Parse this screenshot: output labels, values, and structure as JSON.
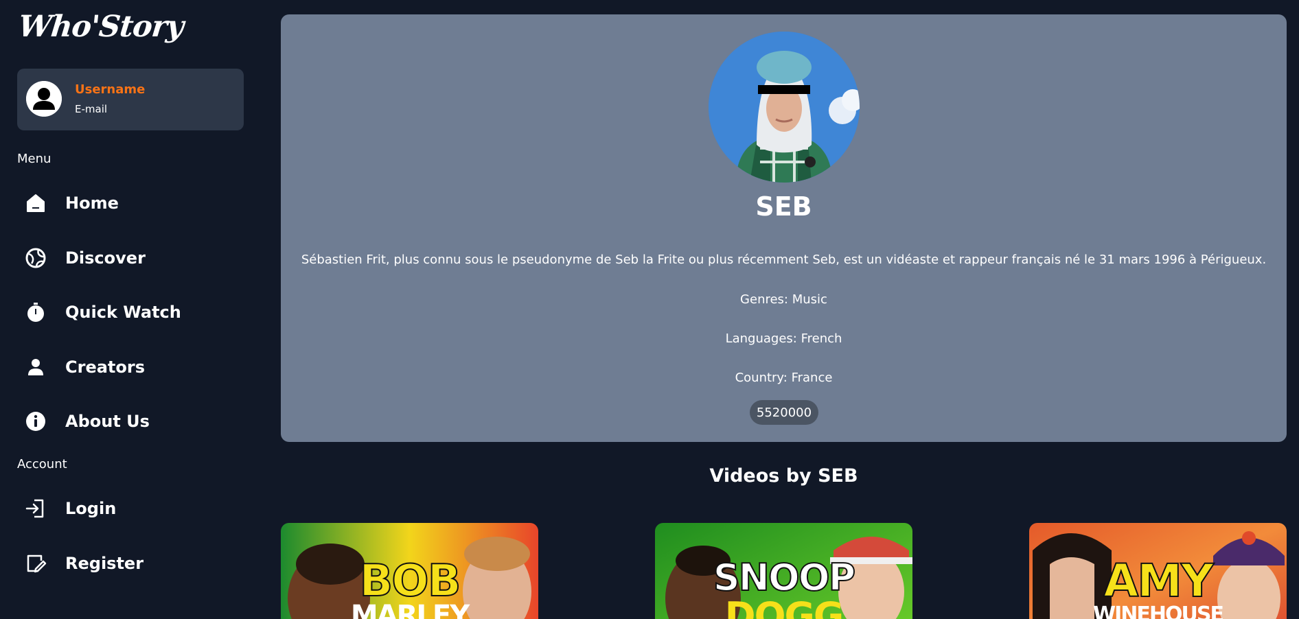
{
  "app": {
    "logo": "Who'Story"
  },
  "profile": {
    "username": "Username",
    "email": "E-mail"
  },
  "sidebar": {
    "menu_label": "Menu",
    "account_label": "Account",
    "menu_items": [
      {
        "label": "Home",
        "icon": "home-icon"
      },
      {
        "label": "Discover",
        "icon": "globe-icon"
      },
      {
        "label": "Quick Watch",
        "icon": "stopwatch-icon"
      },
      {
        "label": "Creators",
        "icon": "user-icon"
      },
      {
        "label": "About Us",
        "icon": "info-icon"
      }
    ],
    "account_items": [
      {
        "label": "Login",
        "icon": "login-icon"
      },
      {
        "label": "Register",
        "icon": "register-icon"
      }
    ]
  },
  "creator": {
    "name": "SEB",
    "bio": "Sébastien Frit, plus connu sous le pseudonyme de Seb la Frite ou plus récemment Seb, est un vidéaste et rappeur français né le 31 mars 1996 à Périgueux.",
    "genres": "Genres: Music",
    "languages": "Languages: French",
    "country": "Country: France",
    "subscribers": "5520000"
  },
  "videos": {
    "title": "Videos by SEB",
    "items": [
      {
        "line1": "BOB",
        "line2": "MARLEY"
      },
      {
        "line1": "SNOOP",
        "line2": "DOGG"
      },
      {
        "line1": "AMY",
        "line2": "WINEHOUSE"
      }
    ]
  },
  "colors": {
    "background": "#111827",
    "profile_card": "#2d3748",
    "accent": "#f97316",
    "creator_card": "#6f7d93",
    "badge": "#4b5563"
  }
}
